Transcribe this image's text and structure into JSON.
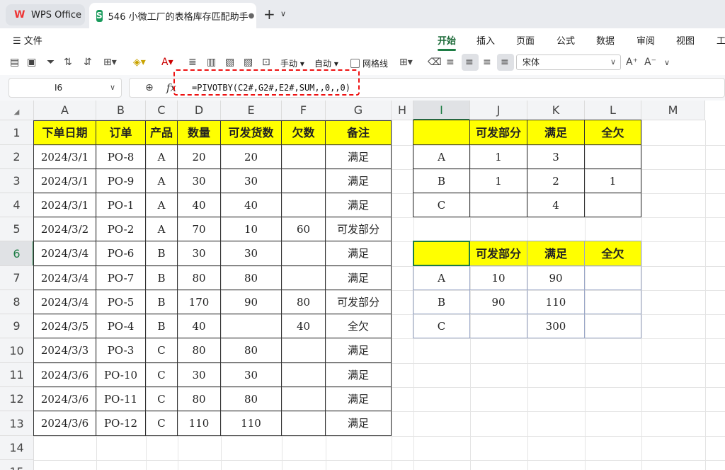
{
  "tabs": {
    "home_label": "WPS Office",
    "doc_label": "546 小微工厂的表格库存匹配助手"
  },
  "menu": {
    "file": "文件",
    "tabs": [
      "开始",
      "插入",
      "页面",
      "公式",
      "数据",
      "审阅",
      "视图",
      "工"
    ],
    "active": "开始"
  },
  "toolbar": {
    "manual": "手动",
    "auto": "自动",
    "gridlines": "网格线",
    "font": "宋体"
  },
  "formula_bar": {
    "cell_ref": "I6",
    "formula": "=PIVOTBY(C2#,G2#,E2#,SUM,,0,,0)"
  },
  "columns": [
    "A",
    "B",
    "C",
    "D",
    "E",
    "F",
    "G",
    "H",
    "I",
    "J",
    "K",
    "L",
    "M"
  ],
  "selected_column": "I",
  "rows": [
    "1",
    "2",
    "3",
    "4",
    "5",
    "6",
    "7",
    "8",
    "9",
    "10",
    "11",
    "12",
    "13",
    "14",
    "15"
  ],
  "selected_row": "6",
  "main_table": {
    "headers": [
      "下单日期",
      "订单",
      "产品",
      "数量",
      "可发货数",
      "欠数",
      "备注"
    ],
    "rows": [
      [
        "2024/3/1",
        "PO-8",
        "A",
        "20",
        "20",
        "",
        "满足"
      ],
      [
        "2024/3/1",
        "PO-9",
        "A",
        "30",
        "30",
        "",
        "满足"
      ],
      [
        "2024/3/1",
        "PO-1",
        "A",
        "40",
        "40",
        "",
        "满足"
      ],
      [
        "2024/3/2",
        "PO-2",
        "A",
        "70",
        "10",
        "60",
        "可发部分"
      ],
      [
        "2024/3/4",
        "PO-6",
        "B",
        "30",
        "30",
        "",
        "满足"
      ],
      [
        "2024/3/4",
        "PO-7",
        "B",
        "80",
        "80",
        "",
        "满足"
      ],
      [
        "2024/3/4",
        "PO-5",
        "B",
        "170",
        "90",
        "80",
        "可发部分"
      ],
      [
        "2024/3/5",
        "PO-4",
        "B",
        "40",
        "",
        "40",
        "全欠"
      ],
      [
        "2024/3/3",
        "PO-3",
        "C",
        "80",
        "80",
        "",
        "满足"
      ],
      [
        "2024/3/6",
        "PO-10",
        "C",
        "30",
        "30",
        "",
        "满足"
      ],
      [
        "2024/3/6",
        "PO-11",
        "C",
        "80",
        "80",
        "",
        "满足"
      ],
      [
        "2024/3/6",
        "PO-12",
        "C",
        "110",
        "110",
        "",
        "满足"
      ]
    ]
  },
  "pivot_count": {
    "headers": [
      "",
      "可发部分",
      "满足",
      "全欠"
    ],
    "rows": [
      [
        "A",
        "1",
        "3",
        ""
      ],
      [
        "B",
        "1",
        "2",
        "1"
      ],
      [
        "C",
        "",
        "4",
        ""
      ]
    ]
  },
  "pivot_sum": {
    "headers": [
      "",
      "可发部分",
      "满足",
      "全欠"
    ],
    "rows": [
      [
        "A",
        "10",
        "90",
        ""
      ],
      [
        "B",
        "90",
        "110",
        ""
      ],
      [
        "C",
        "",
        "300",
        ""
      ]
    ]
  },
  "colors": {
    "header_yellow": "#ffff00",
    "accent_green": "#1e7d45",
    "highlight_red": "#e11111"
  }
}
